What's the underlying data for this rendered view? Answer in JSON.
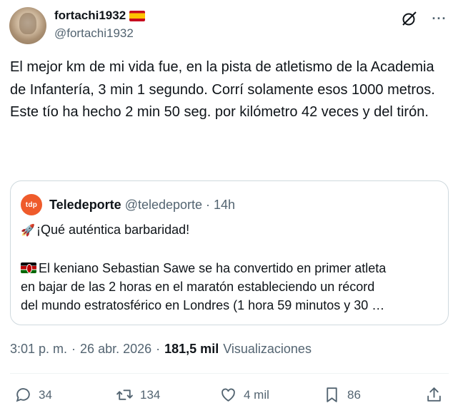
{
  "author": {
    "display_name": "fortachi1932",
    "handle": "@fortachi1932"
  },
  "tweet": {
    "lines": [
      "El mejor km de mi vida fue, en la pista de atletismo de la Academia de Infantería, 3 min 1 segundo. Corrí solamente esos 1000 metros.",
      "Este tío ha hecho 2 min 50 seg. por kilómetro 42 veces y del tirón."
    ]
  },
  "quote": {
    "logo_text": "tdp",
    "display_name": "Teledeporte",
    "handle": "@teledeporte",
    "separator": "·",
    "time": "14h",
    "line1": "¡Qué auténtica barbaridad!",
    "line2": "El keniano Sebastian Sawe se ha convertido en primer atleta",
    "line3": "en bajar de las 2 horas en el maratón estableciendo un récord",
    "line4": "del mundo estratosférico en Londres (1 hora 59 minutos y 30 …"
  },
  "meta": {
    "time": "3:01 p. m.",
    "separator1": "·",
    "date": "26 abr. 2026",
    "separator2": "·",
    "views_count": "181,5 mil",
    "views_label": "Visualizaciones"
  },
  "actions": {
    "replies": "34",
    "reposts": "134",
    "likes": "4 mil",
    "bookmarks": "86"
  },
  "icons": {
    "grok": "grok-icon",
    "more": "more-icon",
    "reply": "reply-icon",
    "repost": "repost-icon",
    "like": "heart-icon",
    "bookmark": "bookmark-icon",
    "share": "share-icon"
  },
  "colors": {
    "text": "#0f1419",
    "secondary": "#536471",
    "border": "#cfd9de",
    "teledeporte": "#ef5b2b"
  }
}
